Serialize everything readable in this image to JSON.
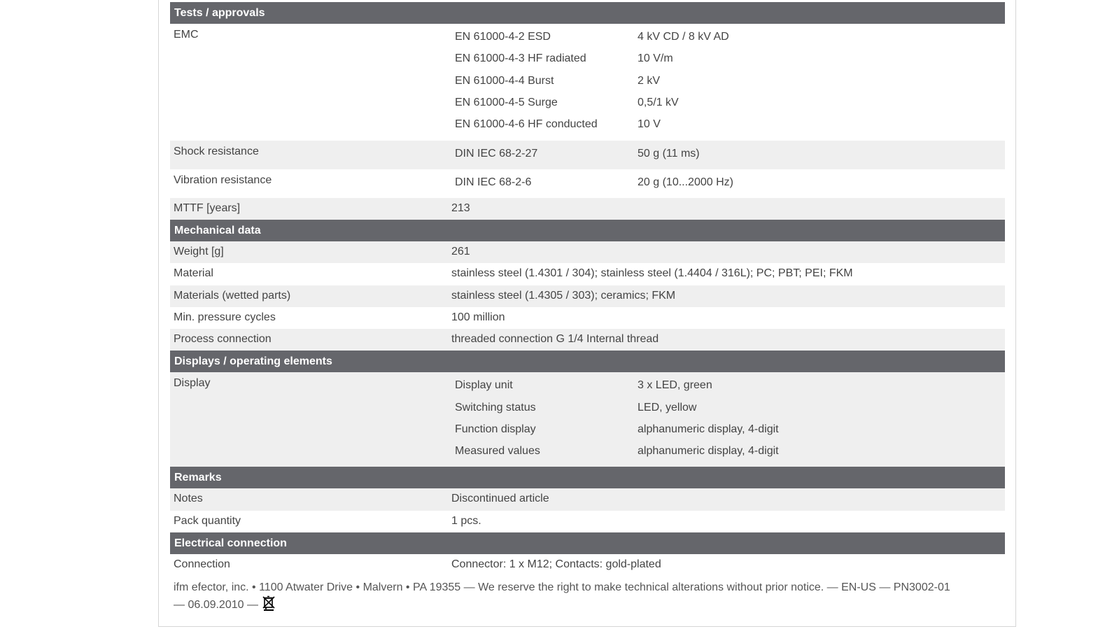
{
  "sections": {
    "tests": {
      "title": "Tests / approvals",
      "emc_label": "EMC",
      "emc": [
        {
          "k": "EN 61000-4-2 ESD",
          "v": "4 kV CD / 8 kV AD"
        },
        {
          "k": "EN 61000-4-3 HF radiated",
          "v": "10 V/m"
        },
        {
          "k": "EN 61000-4-4 Burst",
          "v": "2 kV"
        },
        {
          "k": "EN 61000-4-5 Surge",
          "v": "0,5/1 kV"
        },
        {
          "k": "EN 61000-4-6 HF conducted",
          "v": "10 V"
        }
      ],
      "shock_label": "Shock resistance",
      "shock": {
        "k": "DIN IEC 68-2-27",
        "v": "50 g (11 ms)"
      },
      "vibration_label": "Vibration resistance",
      "vibration": {
        "k": "DIN IEC 68-2-6",
        "v": "20 g (10...2000 Hz)"
      },
      "mttf_label": "MTTF [years]",
      "mttf_value": "213"
    },
    "mechanical": {
      "title": "Mechanical data",
      "rows": [
        {
          "label": "Weight [g]",
          "value": "261"
        },
        {
          "label": "Material",
          "value": "stainless steel (1.4301 / 304); stainless steel (1.4404 / 316L); PC; PBT; PEI; FKM"
        },
        {
          "label": "Materials (wetted parts)",
          "value": "stainless steel (1.4305 / 303); ceramics; FKM"
        },
        {
          "label": "Min. pressure cycles",
          "value": "100 million"
        },
        {
          "label": "Process connection",
          "value": "threaded connection G 1/4 Internal thread"
        }
      ]
    },
    "displays": {
      "title": "Displays / operating elements",
      "display_label": "Display",
      "items": [
        {
          "k": "Display unit",
          "v": "3 x LED, green"
        },
        {
          "k": "Switching status",
          "v": "LED, yellow"
        },
        {
          "k": "Function display",
          "v": "alphanumeric display, 4-digit"
        },
        {
          "k": "Measured values",
          "v": "alphanumeric display, 4-digit"
        }
      ]
    },
    "remarks": {
      "title": "Remarks",
      "rows": [
        {
          "label": "Notes",
          "value": "Discontinued article"
        },
        {
          "label": "Pack quantity",
          "value": "1 pcs."
        }
      ]
    },
    "electrical": {
      "title": "Electrical connection",
      "rows": [
        {
          "label": "Connection",
          "value": "Connector: 1 x M12; Contacts: gold-plated"
        }
      ]
    }
  },
  "footer": {
    "text": "ifm efector, inc. • 1100 Atwater Drive • Malvern • PA 19355 — We reserve the right to make technical alterations without prior notice. — EN-US — PN3002-01 — 06.09.2010 —",
    "icon": "crossed-out-wheelie-bin-icon"
  },
  "colors": {
    "header_bg": "#65666b",
    "row_shade": "#efefef",
    "text": "#444444"
  }
}
